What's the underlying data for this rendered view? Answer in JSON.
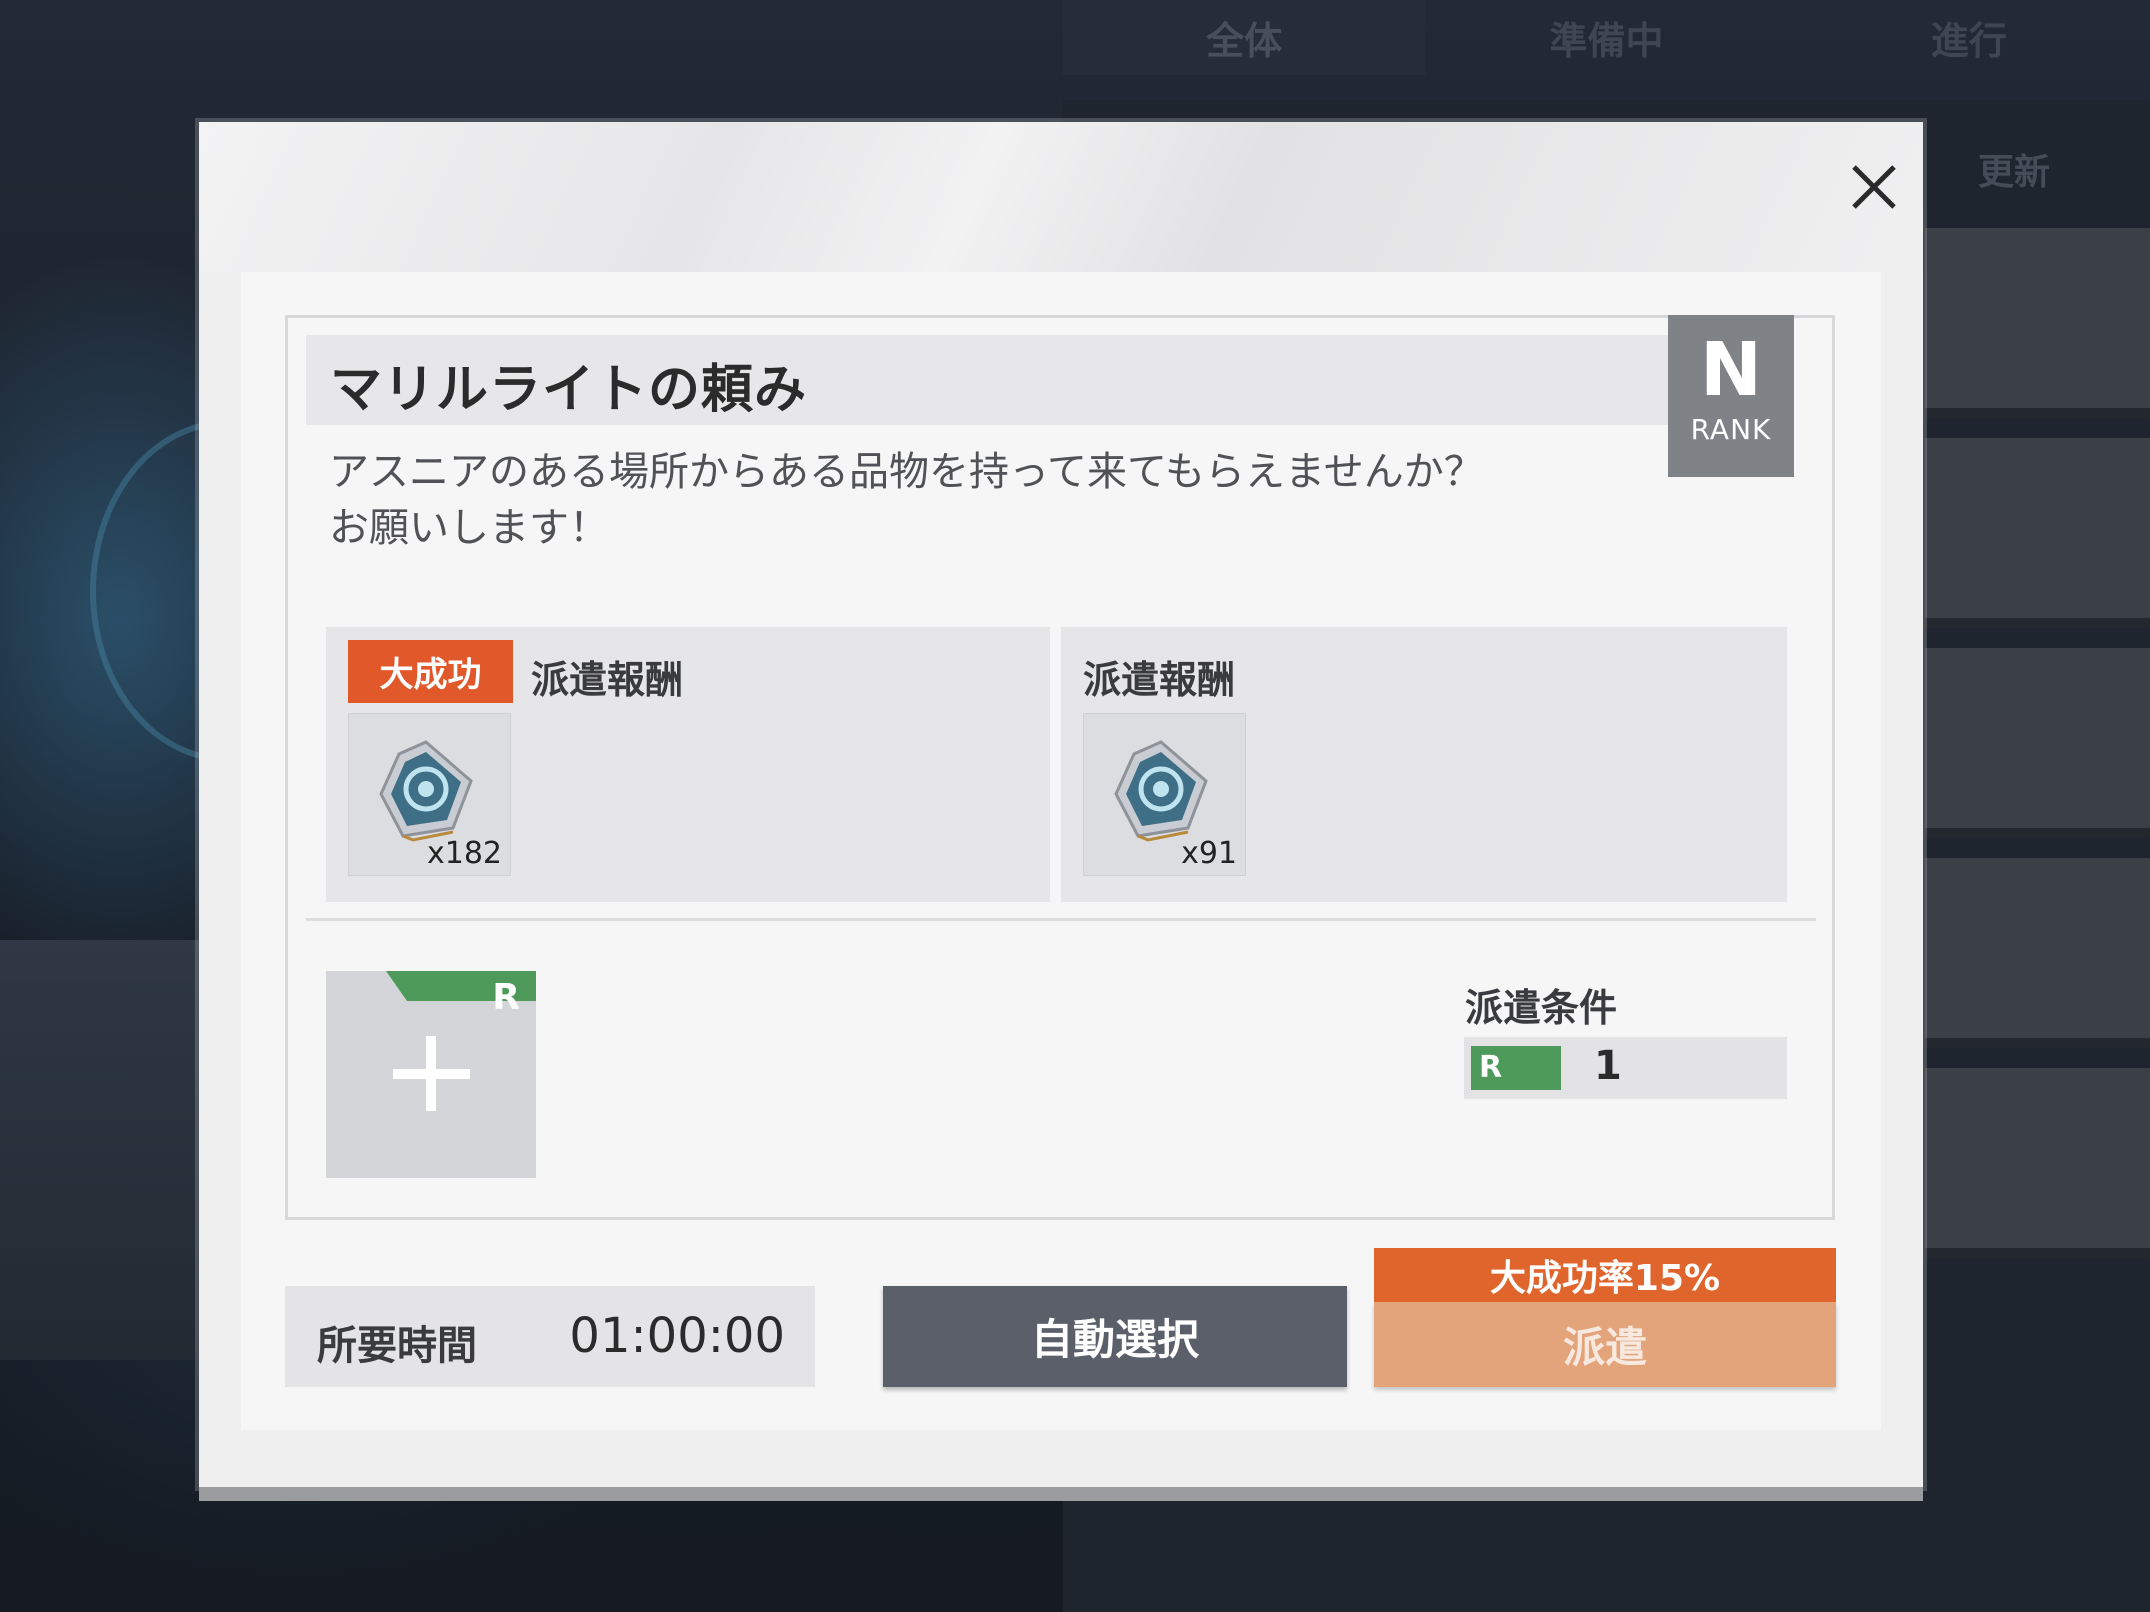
{
  "background": {
    "tabs": [
      {
        "label": "全体",
        "active": true
      },
      {
        "label": "準備中",
        "active": false
      },
      {
        "label": "進行",
        "active": false
      }
    ],
    "refresh_label": "更新"
  },
  "mission": {
    "title": "マリルライトの頼み",
    "rank_letter": "N",
    "rank_caption": "RANK",
    "description_lines": [
      "アスニアのある場所からある品物を持って来てもらえませんか？",
      "お願いします！"
    ]
  },
  "rewards": {
    "great_success": {
      "badge": "大成功",
      "label": "派遣報酬",
      "item_icon": "gear-chip-icon",
      "count": "x182"
    },
    "normal": {
      "label": "派遣報酬",
      "item_icon": "gear-chip-icon",
      "count": "x91"
    }
  },
  "party_slot": {
    "rank_tag": "R",
    "tag_color": "#4e9a5a"
  },
  "condition": {
    "label": "派遣条件",
    "rank": "R",
    "value": "1"
  },
  "footer": {
    "time_label": "所要時間",
    "time_value": "01:00:00",
    "auto_select_label": "自動選択",
    "success_rate": "大成功率15%",
    "dispatch_label": "派遣"
  },
  "colors": {
    "accent_orange": "#e1582b",
    "dispatch_disabled": "#e3a47c",
    "rank_green": "#4e9a5a",
    "rank_badge_gray": "#7f8287"
  }
}
